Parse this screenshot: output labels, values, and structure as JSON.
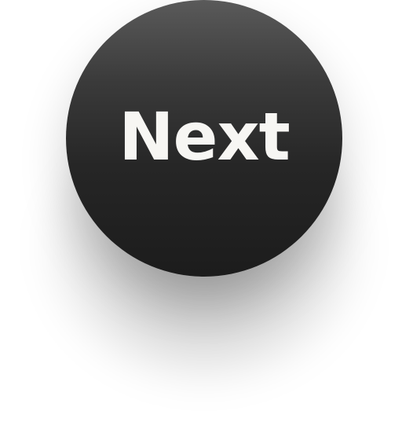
{
  "button": {
    "label": "Next",
    "background_top": "#5a5a5a",
    "background_bottom": "#1c1c1c",
    "text_color": "#f7f6f3"
  }
}
